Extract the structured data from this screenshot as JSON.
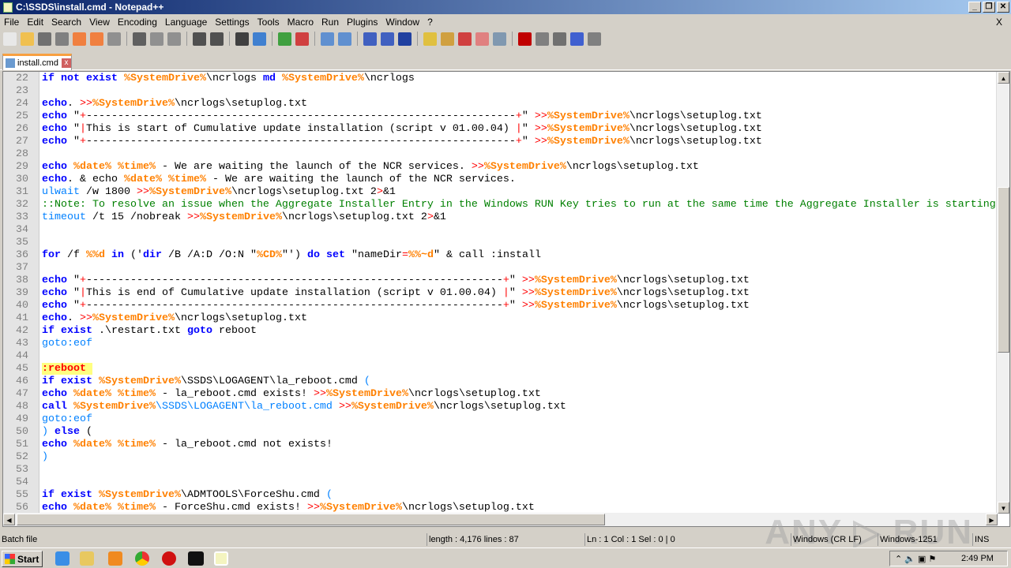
{
  "window": {
    "title": "C:\\SSDS\\install.cmd - Notepad++"
  },
  "menu": [
    "File",
    "Edit",
    "Search",
    "View",
    "Encoding",
    "Language",
    "Settings",
    "Tools",
    "Macro",
    "Run",
    "Plugins",
    "Window",
    "?"
  ],
  "menu_close": "X",
  "tab": {
    "label": "install.cmd",
    "close": "x"
  },
  "code_lines": [
    {
      "n": "22",
      "t": [
        [
          "k",
          "if not exist "
        ],
        [
          "v",
          "%SystemDrive%"
        ],
        [
          "t",
          "\\ncrlogs "
        ],
        [
          "k",
          "md "
        ],
        [
          "v",
          "%SystemDrive%"
        ],
        [
          "t",
          "\\ncrlogs"
        ]
      ]
    },
    {
      "n": "23",
      "t": []
    },
    {
      "n": "24",
      "t": [
        [
          "k",
          "echo"
        ],
        [
          "t",
          ". "
        ],
        [
          "o",
          ">>"
        ],
        [
          "v",
          "%SystemDrive%"
        ],
        [
          "t",
          "\\ncrlogs\\setuplog.txt"
        ]
      ]
    },
    {
      "n": "25",
      "t": [
        [
          "k",
          "echo "
        ],
        [
          "t",
          "\""
        ],
        [
          "o",
          "+"
        ],
        [
          "t",
          "--------------------------------------------------------------------"
        ],
        [
          "o",
          "+"
        ],
        [
          "t",
          "\" "
        ],
        [
          "o",
          ">>"
        ],
        [
          "v",
          "%SystemDrive%"
        ],
        [
          "t",
          "\\ncrlogs\\setuplog.txt"
        ]
      ]
    },
    {
      "n": "26",
      "t": [
        [
          "k",
          "echo "
        ],
        [
          "t",
          "\""
        ],
        [
          "o",
          "|"
        ],
        [
          "t",
          "This is start of Cumulative update installation (script v 01.00.04) "
        ],
        [
          "o",
          "|"
        ],
        [
          "t",
          "\" "
        ],
        [
          "o",
          ">>"
        ],
        [
          "v",
          "%SystemDrive%"
        ],
        [
          "t",
          "\\ncrlogs\\setuplog.txt"
        ]
      ]
    },
    {
      "n": "27",
      "t": [
        [
          "k",
          "echo "
        ],
        [
          "t",
          "\""
        ],
        [
          "o",
          "+"
        ],
        [
          "t",
          "--------------------------------------------------------------------"
        ],
        [
          "o",
          "+"
        ],
        [
          "t",
          "\" "
        ],
        [
          "o",
          ">>"
        ],
        [
          "v",
          "%SystemDrive%"
        ],
        [
          "t",
          "\\ncrlogs\\setuplog.txt"
        ]
      ]
    },
    {
      "n": "28",
      "t": []
    },
    {
      "n": "29",
      "t": [
        [
          "k",
          "echo "
        ],
        [
          "v",
          "%date%"
        ],
        [
          "t",
          " "
        ],
        [
          "v",
          "%time%"
        ],
        [
          "t",
          " - We are waiting the launch of the NCR services. "
        ],
        [
          "o",
          ">>"
        ],
        [
          "v",
          "%SystemDrive%"
        ],
        [
          "t",
          "\\ncrlogs\\setuplog.txt"
        ]
      ]
    },
    {
      "n": "30",
      "t": [
        [
          "k",
          "echo"
        ],
        [
          "t",
          ". & echo "
        ],
        [
          "v",
          "%date%"
        ],
        [
          "t",
          " "
        ],
        [
          "v",
          "%time%"
        ],
        [
          "t",
          " - We are waiting the launch of the NCR services."
        ]
      ]
    },
    {
      "n": "31",
      "t": [
        [
          "l",
          "ulwait"
        ],
        [
          "t",
          " /w 1800 "
        ],
        [
          "o",
          ">>"
        ],
        [
          "v",
          "%SystemDrive%"
        ],
        [
          "t",
          "\\ncrlogs\\setuplog.txt 2"
        ],
        [
          "o",
          ">"
        ],
        [
          "t",
          "&1"
        ]
      ]
    },
    {
      "n": "32",
      "t": [
        [
          "c",
          "::Note: To resolve an issue when the Aggregate Installer Entry in the Windows RUN Key tries to run at the same time the Aggregate Installer is starting"
        ]
      ]
    },
    {
      "n": "33",
      "t": [
        [
          "l",
          "timeout"
        ],
        [
          "t",
          " /t 15 /nobreak "
        ],
        [
          "o",
          ">>"
        ],
        [
          "v",
          "%SystemDrive%"
        ],
        [
          "t",
          "\\ncrlogs\\setuplog.txt 2"
        ],
        [
          "o",
          ">"
        ],
        [
          "t",
          "&1"
        ]
      ]
    },
    {
      "n": "34",
      "t": []
    },
    {
      "n": "35",
      "t": []
    },
    {
      "n": "36",
      "t": [
        [
          "k",
          "for"
        ],
        [
          "t",
          " /f "
        ],
        [
          "v",
          "%%d"
        ],
        [
          "t",
          " "
        ],
        [
          "k",
          "in"
        ],
        [
          "t",
          " ('"
        ],
        [
          "k",
          "dir"
        ],
        [
          "t",
          " /B /A:D /O:N \""
        ],
        [
          "v",
          "%CD%"
        ],
        [
          "t",
          "\"') "
        ],
        [
          "k",
          "do set"
        ],
        [
          "t",
          " \"nameDir"
        ],
        [
          "o",
          "="
        ],
        [
          "v",
          "%%~d"
        ],
        [
          "t",
          "\" & call :install"
        ]
      ]
    },
    {
      "n": "37",
      "t": []
    },
    {
      "n": "38",
      "t": [
        [
          "k",
          "echo "
        ],
        [
          "t",
          "\""
        ],
        [
          "o",
          "+"
        ],
        [
          "t",
          "------------------------------------------------------------------"
        ],
        [
          "o",
          "+"
        ],
        [
          "t",
          "\" "
        ],
        [
          "o",
          ">>"
        ],
        [
          "v",
          "%SystemDrive%"
        ],
        [
          "t",
          "\\ncrlogs\\setuplog.txt"
        ]
      ]
    },
    {
      "n": "39",
      "t": [
        [
          "k",
          "echo "
        ],
        [
          "t",
          "\""
        ],
        [
          "o",
          "|"
        ],
        [
          "t",
          "This is end of Cumulative update installation (script v 01.00.04) "
        ],
        [
          "o",
          "|"
        ],
        [
          "t",
          "\" "
        ],
        [
          "o",
          ">>"
        ],
        [
          "v",
          "%SystemDrive%"
        ],
        [
          "t",
          "\\ncrlogs\\setuplog.txt"
        ]
      ]
    },
    {
      "n": "40",
      "t": [
        [
          "k",
          "echo "
        ],
        [
          "t",
          "\""
        ],
        [
          "o",
          "+"
        ],
        [
          "t",
          "------------------------------------------------------------------"
        ],
        [
          "o",
          "+"
        ],
        [
          "t",
          "\" "
        ],
        [
          "o",
          ">>"
        ],
        [
          "v",
          "%SystemDrive%"
        ],
        [
          "t",
          "\\ncrlogs\\setuplog.txt"
        ]
      ]
    },
    {
      "n": "41",
      "t": [
        [
          "k",
          "echo"
        ],
        [
          "t",
          ". "
        ],
        [
          "o",
          ">>"
        ],
        [
          "v",
          "%SystemDrive%"
        ],
        [
          "t",
          "\\ncrlogs\\setuplog.txt"
        ]
      ]
    },
    {
      "n": "42",
      "t": [
        [
          "k",
          "if exist"
        ],
        [
          "t",
          " .\\restart.txt "
        ],
        [
          "k",
          "goto"
        ],
        [
          "t",
          " reboot"
        ]
      ]
    },
    {
      "n": "43",
      "t": [
        [
          "l",
          "goto:eof"
        ]
      ]
    },
    {
      "n": "44",
      "t": []
    },
    {
      "n": "45",
      "t": [
        [
          "lb",
          ":reboot "
        ]
      ]
    },
    {
      "n": "46",
      "t": [
        [
          "k",
          "if exist "
        ],
        [
          "v",
          "%SystemDrive%"
        ],
        [
          "t",
          "\\SSDS\\LOGAGENT\\la_reboot.cmd "
        ],
        [
          "l",
          "("
        ]
      ]
    },
    {
      "n": "47",
      "t": [
        [
          "k",
          "echo "
        ],
        [
          "v",
          "%date%"
        ],
        [
          "t",
          " "
        ],
        [
          "v",
          "%time%"
        ],
        [
          "t",
          " - la_reboot.cmd exists! "
        ],
        [
          "o",
          ">>"
        ],
        [
          "v",
          "%SystemDrive%"
        ],
        [
          "t",
          "\\ncrlogs\\setuplog.txt"
        ]
      ]
    },
    {
      "n": "48",
      "t": [
        [
          "k",
          "call "
        ],
        [
          "v",
          "%SystemDrive%"
        ],
        [
          "l",
          "\\SSDS\\LOGAGENT\\la_reboot.cmd "
        ],
        [
          "o",
          ">>"
        ],
        [
          "v",
          "%SystemDrive%"
        ],
        [
          "t",
          "\\ncrlogs\\setuplog.txt"
        ]
      ]
    },
    {
      "n": "49",
      "t": [
        [
          "l",
          "goto:eof"
        ]
      ]
    },
    {
      "n": "50",
      "t": [
        [
          "l",
          ")"
        ],
        [
          "k",
          " else "
        ],
        [
          "t",
          "("
        ]
      ]
    },
    {
      "n": "51",
      "t": [
        [
          "k",
          "echo "
        ],
        [
          "v",
          "%date%"
        ],
        [
          "t",
          " "
        ],
        [
          "v",
          "%time%"
        ],
        [
          "t",
          " - la_reboot.cmd not exists!"
        ]
      ]
    },
    {
      "n": "52",
      "t": [
        [
          "l",
          ")"
        ]
      ]
    },
    {
      "n": "53",
      "t": []
    },
    {
      "n": "54",
      "t": []
    },
    {
      "n": "55",
      "t": [
        [
          "k",
          "if exist "
        ],
        [
          "v",
          "%SystemDrive%"
        ],
        [
          "t",
          "\\ADMTOOLS\\ForceShu.cmd "
        ],
        [
          "l",
          "("
        ]
      ]
    },
    {
      "n": "56",
      "t": [
        [
          "k",
          "echo "
        ],
        [
          "v",
          "%date%"
        ],
        [
          "t",
          " "
        ],
        [
          "v",
          "%time%"
        ],
        [
          "t",
          " - ForceShu.cmd exists! "
        ],
        [
          "o",
          ">>"
        ],
        [
          "v",
          "%SystemDrive%"
        ],
        [
          "t",
          "\\ncrlogs\\setuplog.txt"
        ]
      ]
    }
  ],
  "status": {
    "type": "Batch file",
    "length": "length : 4,176    lines : 87",
    "pos": "Ln : 1    Col : 1    Sel : 0 | 0",
    "eol": "Windows (CR LF)",
    "encoding": "Windows-1251",
    "mode": "INS"
  },
  "taskbar": {
    "start": "Start",
    "clock": "2:49 PM"
  },
  "watermark": "ANY RUN",
  "colors": {
    "keyword": "#0000ff",
    "variable": "#ff8000",
    "operator": "#ff0000",
    "comment": "#008000",
    "label": "#0080ff"
  }
}
